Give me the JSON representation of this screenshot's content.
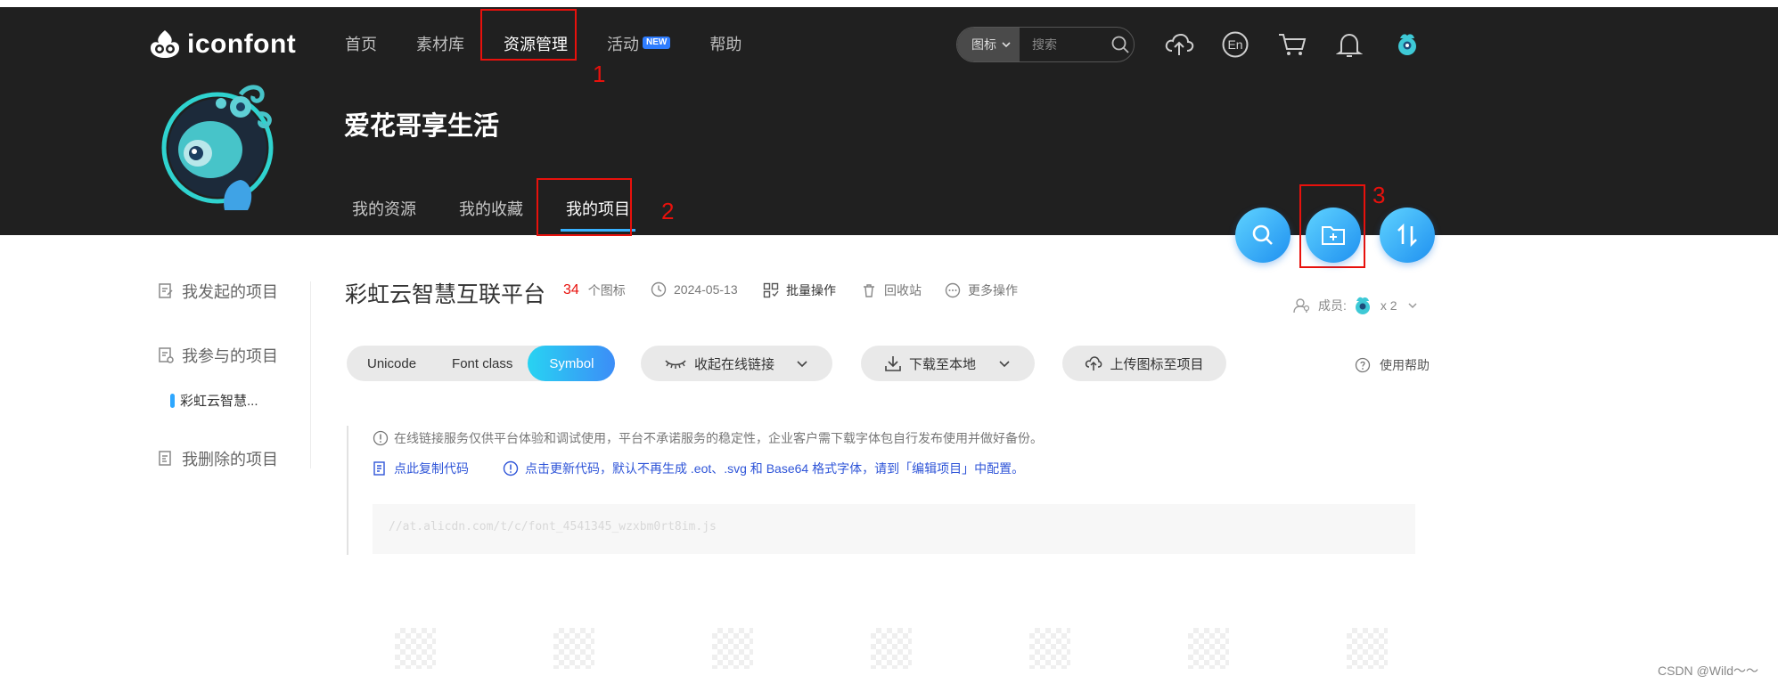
{
  "header": {
    "logo_text": "iconfont",
    "nav": [
      {
        "label": "首页"
      },
      {
        "label": "素材库"
      },
      {
        "label": "资源管理"
      },
      {
        "label": "活动",
        "badge": "NEW"
      },
      {
        "label": "帮助"
      }
    ],
    "search": {
      "type_label": "图标",
      "placeholder": "搜索"
    },
    "icons": [
      "upload-cloud-icon",
      "language-en-icon",
      "cart-icon",
      "bell-icon",
      "user-avatar"
    ],
    "en_label": "En"
  },
  "profile": {
    "name": "爱花哥享生活",
    "tabs": [
      {
        "label": "我的资源"
      },
      {
        "label": "我的收藏"
      },
      {
        "label": "我的项目"
      }
    ]
  },
  "annotations": [
    "1",
    "2",
    "3"
  ],
  "sidebar": {
    "items": [
      {
        "label": "我发起的项目"
      },
      {
        "label": "我参与的项目"
      },
      {
        "label": "我删除的项目"
      }
    ],
    "sub_item": "彩虹云智慧..."
  },
  "project": {
    "title": "彩虹云智慧互联平台",
    "icon_count": "34",
    "icon_count_unit": "个图标",
    "date": "2024-05-13",
    "batch_label": "批量操作",
    "recycle_label": "回收站",
    "more_label": "更多操作",
    "members_label": "成员:",
    "members_count": "x 2"
  },
  "toolbar": {
    "formats": [
      "Unicode",
      "Font class",
      "Symbol"
    ],
    "active_format": "Symbol",
    "collapse_label": "收起在线链接",
    "download_label": "下载至本地",
    "upload_label": "上传图标至项目",
    "help_label": "使用帮助"
  },
  "notice": {
    "text": "在线链接服务仅供平台体验和调试使用，平台不承诺服务的稳定性，企业客户需下载字体包自行发布使用并做好备份。",
    "copy_label": "点此复制代码",
    "update_label": "点击更新代码，默认不再生成 .eot、.svg 和 Base64 格式字体，请到「编辑项目」中配置。",
    "code": "//at.alicdn.com/t/c/font_4541345_wzxbm0rt8im.js"
  },
  "colors": {
    "accent": "#2f9bff",
    "annotation": "#e8110c",
    "header_bg": "#202020"
  },
  "watermark": "CSDN @Wild～～"
}
